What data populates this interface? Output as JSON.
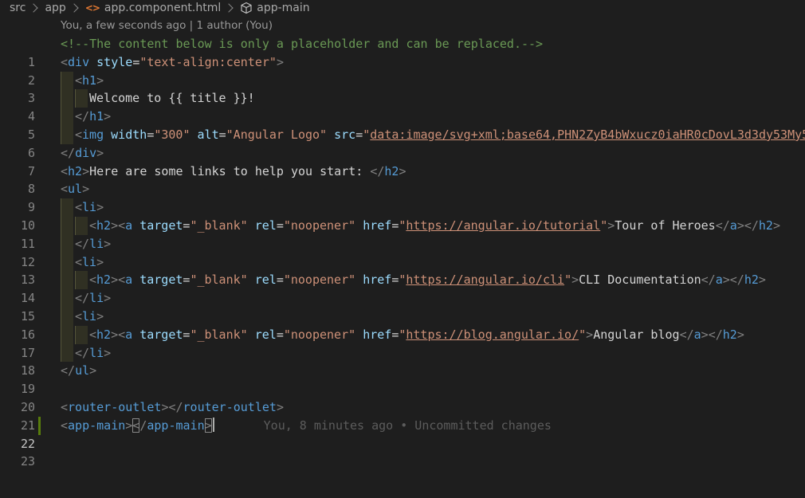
{
  "breadcrumb": {
    "items": [
      "src",
      "app",
      "app.component.html",
      "app-main"
    ],
    "html_icon_name": "html-file-icon",
    "symbol_icon_name": "symbol-class-icon"
  },
  "codelens": {
    "text": "You, a few seconds ago | 1 author (You)"
  },
  "editor": {
    "active_line": 22,
    "lines": [
      {
        "n": "1"
      },
      {
        "n": "2"
      },
      {
        "n": "3"
      },
      {
        "n": "4"
      },
      {
        "n": "5"
      },
      {
        "n": "6"
      },
      {
        "n": "7"
      },
      {
        "n": "8"
      },
      {
        "n": "9"
      },
      {
        "n": "10"
      },
      {
        "n": "11"
      },
      {
        "n": "12"
      },
      {
        "n": "13"
      },
      {
        "n": "14"
      },
      {
        "n": "15"
      },
      {
        "n": "16"
      },
      {
        "n": "17"
      },
      {
        "n": "18"
      },
      {
        "n": "19"
      },
      {
        "n": "20"
      },
      {
        "n": "21"
      },
      {
        "n": "22"
      },
      {
        "n": "23"
      }
    ],
    "code": {
      "l1_comment": "<!--The content below is only a placeholder and can be replaced.-->",
      "lt": "<",
      "gt": ">",
      "close_lt": "</",
      "eq": "=",
      "div": "div",
      "style_attr": "style",
      "style_val": "\"text-align:center\"",
      "h1": "h1",
      "l4_text": "Welcome to {{ title }}!",
      "img": "img",
      "width_attr": "width",
      "width_val": "\"300\"",
      "alt_attr": "alt",
      "alt_val": "\"Angular Logo\"",
      "src_attr": "src",
      "quote": "\"",
      "img_src_val": "data:image/svg+xml;base64,PHN2ZyB4bWxucz0iaHR0cDovL3d3dy53My5",
      "h2": "h2",
      "l8_text": "Here are some links to help you start: ",
      "ul": "ul",
      "li": "li",
      "a": "a",
      "target_attr": "target",
      "target_val": "\"_blank\"",
      "rel_attr": "rel",
      "rel_val": "\"noopener\"",
      "href_attr": "href",
      "link1_url": "https://angular.io/tutorial",
      "link1_text": "Tour of Heroes",
      "link2_url": "https://angular.io/cli",
      "link2_text": "CLI Documentation",
      "link3_url": "https://blog.angular.io/",
      "link3_text": "Angular blog",
      "router_outlet": "router-outlet",
      "app_main": "app-main",
      "blame_text": "You, 8 minutes ago • Uncommitted changes"
    }
  },
  "colors": {
    "background": "#1e1e1e",
    "tag": "#569cd6",
    "attribute": "#9cdcfe",
    "string": "#ce9178",
    "comment": "#6a9955",
    "gutter_modified": "#587c0c"
  }
}
